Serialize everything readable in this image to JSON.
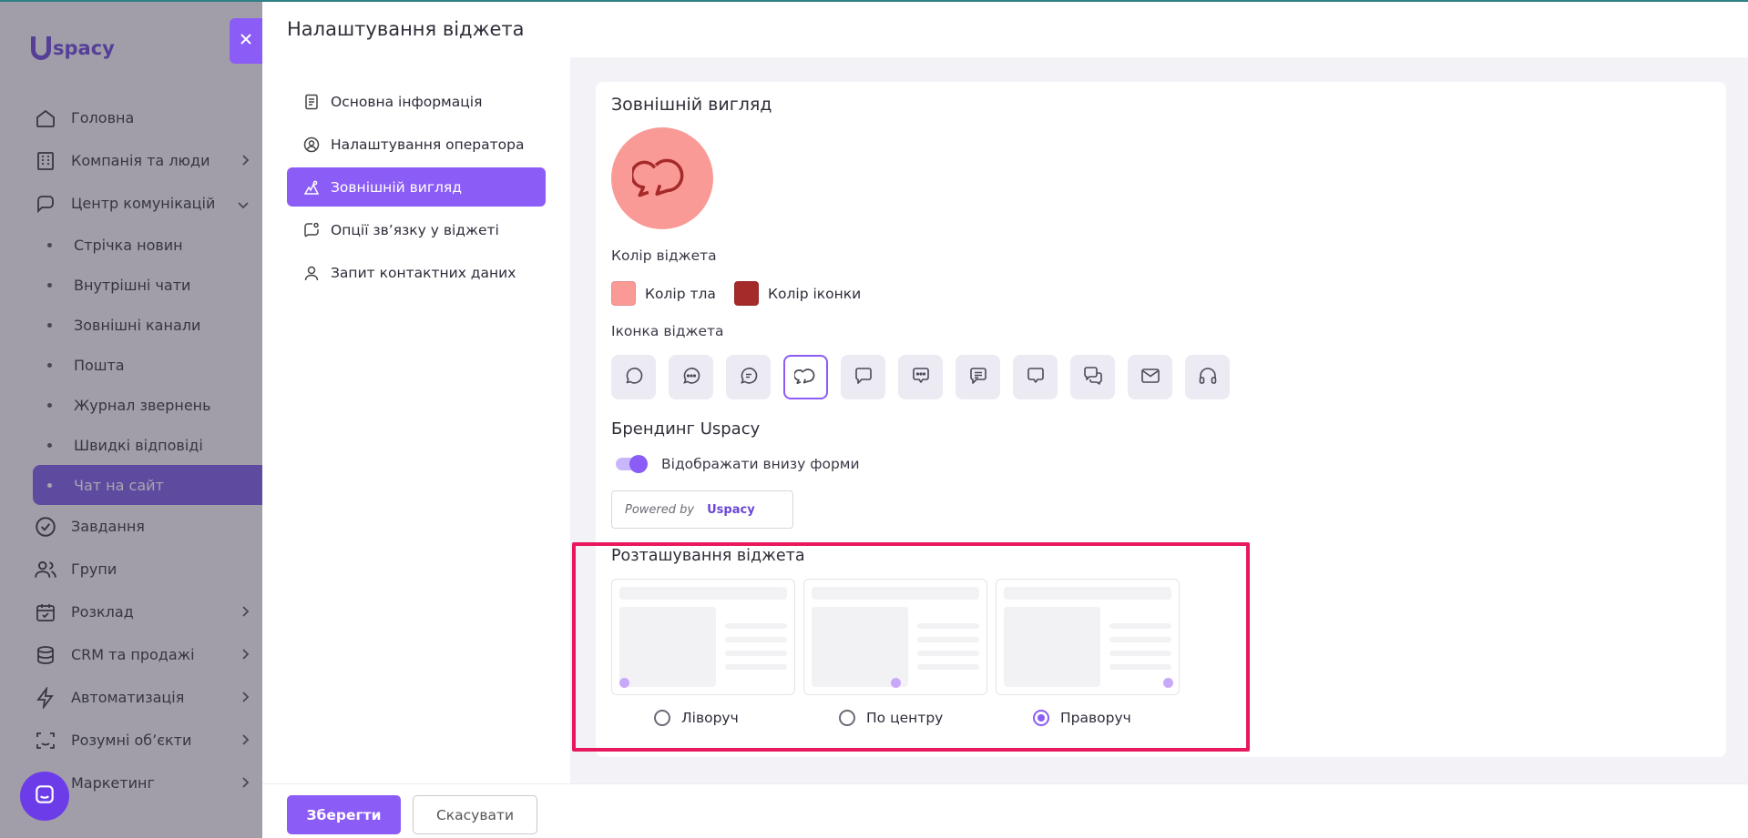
{
  "app": {
    "logo_text": "spacy",
    "nav": [
      {
        "label": "Головна",
        "icon": "home-icon",
        "chevron": false
      },
      {
        "label": "Компанія та люди",
        "icon": "building-icon",
        "chevron": true
      },
      {
        "label": "Центр комунікацій",
        "icon": "communication-icon",
        "chevron": true
      }
    ],
    "subnav": [
      {
        "label": "Стрічка новин"
      },
      {
        "label": "Внутрішні чати"
      },
      {
        "label": "Зовнішні канали"
      },
      {
        "label": "Пошта"
      },
      {
        "label": "Журнал звернень"
      },
      {
        "label": "Швидкі відповіді"
      },
      {
        "label": "Чат на сайт"
      }
    ],
    "nav_bottom": [
      {
        "label": "Завдання",
        "icon": "tasks-icon",
        "chevron": false
      },
      {
        "label": "Групи",
        "icon": "groups-icon",
        "chevron": false
      },
      {
        "label": "Розклад",
        "icon": "calendar-icon",
        "chevron": true
      },
      {
        "label": "CRM та продажі",
        "icon": "crm-icon",
        "chevron": true
      },
      {
        "label": "Автоматизація",
        "icon": "lightning-icon",
        "chevron": true
      },
      {
        "label": "Розумні об’єкти",
        "icon": "smart-objects-icon",
        "chevron": true
      },
      {
        "label": "Маркетинг",
        "icon": "marketing-icon",
        "chevron": true
      }
    ]
  },
  "drawer": {
    "title": "Налаштування віджета",
    "menu": [
      {
        "label": "Основна інформація",
        "icon": "document-icon"
      },
      {
        "label": "Налаштування оператора",
        "icon": "user-circle-icon"
      },
      {
        "label": "Зовнішній вигляд",
        "icon": "appearance-icon"
      },
      {
        "label": "Опції зв’язку у віджеті",
        "icon": "chat-options-icon"
      },
      {
        "label": "Запит контактних даних",
        "icon": "user-icon"
      }
    ]
  },
  "appearance": {
    "heading": "Зовнішній вигляд",
    "color_label": "Колір віджета",
    "bg_color_label": "Колір тла",
    "icon_color_label": "Колір іконки",
    "bg_color": "#fa9a97",
    "icon_color": "#a52a2a",
    "icon_label": "Іконка віджета",
    "branding_heading": "Брендинг Uspacy",
    "branding_toggle_label": "Відображати внизу форми",
    "powered_by": "Powered by",
    "powered_logo": "spacy",
    "position_heading": "Розташування віджета",
    "positions": [
      {
        "label": "Ліворуч"
      },
      {
        "label": "По центру"
      },
      {
        "label": "Праворуч"
      }
    ]
  },
  "footer": {
    "save_label": "Зберегти",
    "cancel_label": "Скасувати"
  }
}
